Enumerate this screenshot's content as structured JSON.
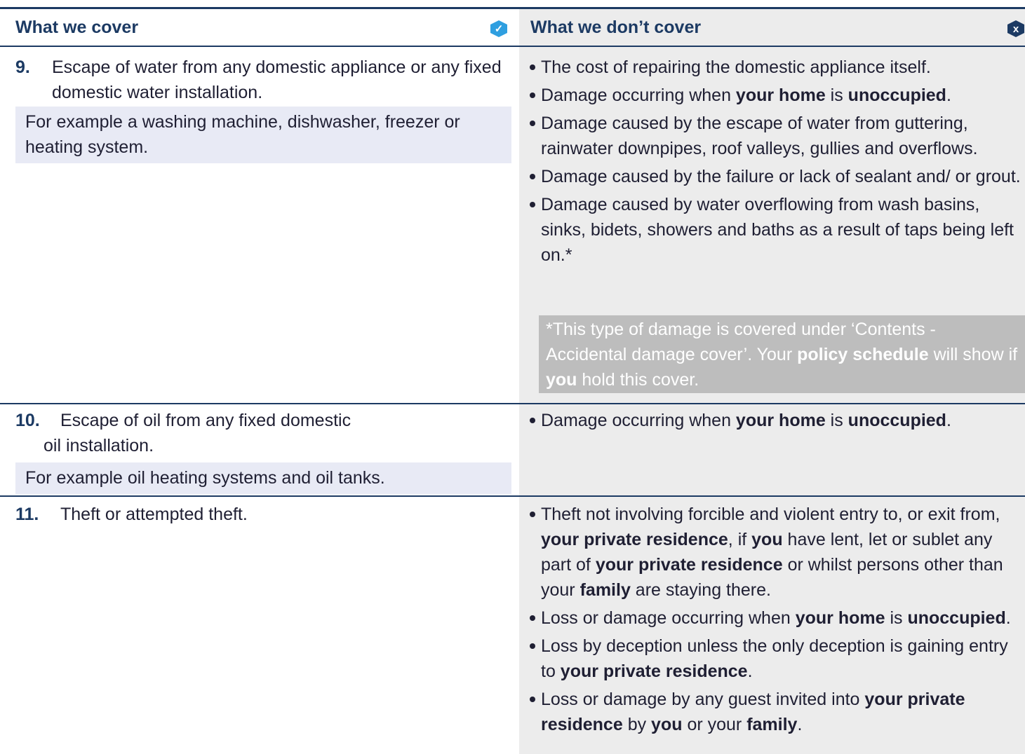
{
  "header": {
    "cover_title": "What we cover",
    "not_cover_title": "What we don’t cover",
    "check_icon": "check-icon",
    "cross_icon": "x-icon",
    "cross_glyph": "x",
    "check_glyph": "✓"
  },
  "rows": [
    {
      "number": "9.",
      "cover_text": "Escape of water from any domestic appliance or any fixed domestic water installation.",
      "example": "For example a washing machine, dishwasher, freezer or heating system.",
      "exclusions": [
        [
          "The cost of repairing the domestic appliance itself."
        ],
        [
          "Damage occurring when ",
          "your home",
          " is ",
          "unoccupied",
          "."
        ],
        [
          "Damage caused by the escape of water from guttering, rainwater downpipes, roof valleys, gullies and overflows."
        ],
        [
          "Damage caused by the failure or lack of sealant and/ or grout."
        ],
        [
          "Damage caused by water overflowing from wash basins, sinks, bidets, showers and baths as a result of taps being left on.*"
        ]
      ],
      "note": [
        "*This type of damage is covered under ‘Contents - Accidental damage cover’. Your ",
        "policy schedule",
        " will show if ",
        "you",
        " hold this cover."
      ]
    },
    {
      "number": "10.",
      "cover_text_1": "Escape of oil from any fixed domestic",
      "cover_text_2": "oil installation.",
      "example": "For example oil heating systems and oil tanks.",
      "exclusions": [
        [
          "Damage occurring when ",
          "your home",
          " is ",
          "unoccupied",
          "."
        ]
      ]
    },
    {
      "number": "11.",
      "cover_text": "Theft or attempted theft.",
      "exclusions": [
        [
          "Theft not involving forcible and violent entry to, or exit from, ",
          "your private residence",
          ", if ",
          "you",
          " have lent, let or sublet any part of ",
          "your private residence",
          " or whilst persons other than your ",
          "family",
          " are staying there."
        ],
        [
          "Loss or damage occurring when ",
          "your home",
          " is ",
          "unoccupied",
          "."
        ],
        [
          "Loss by deception unless the only deception is gaining entry to ",
          "your private residence",
          "."
        ],
        [
          "Loss or damage by any guest invited into ",
          "your private residence",
          " by ",
          "you",
          " or your ",
          "family",
          "."
        ]
      ]
    }
  ],
  "colors": {
    "navy": "#1c3a63",
    "accent_blue": "#2f9fe0",
    "gray_panel": "#ececec",
    "example_bg": "#e8eaf5",
    "note_bg": "#bdbdbd"
  }
}
